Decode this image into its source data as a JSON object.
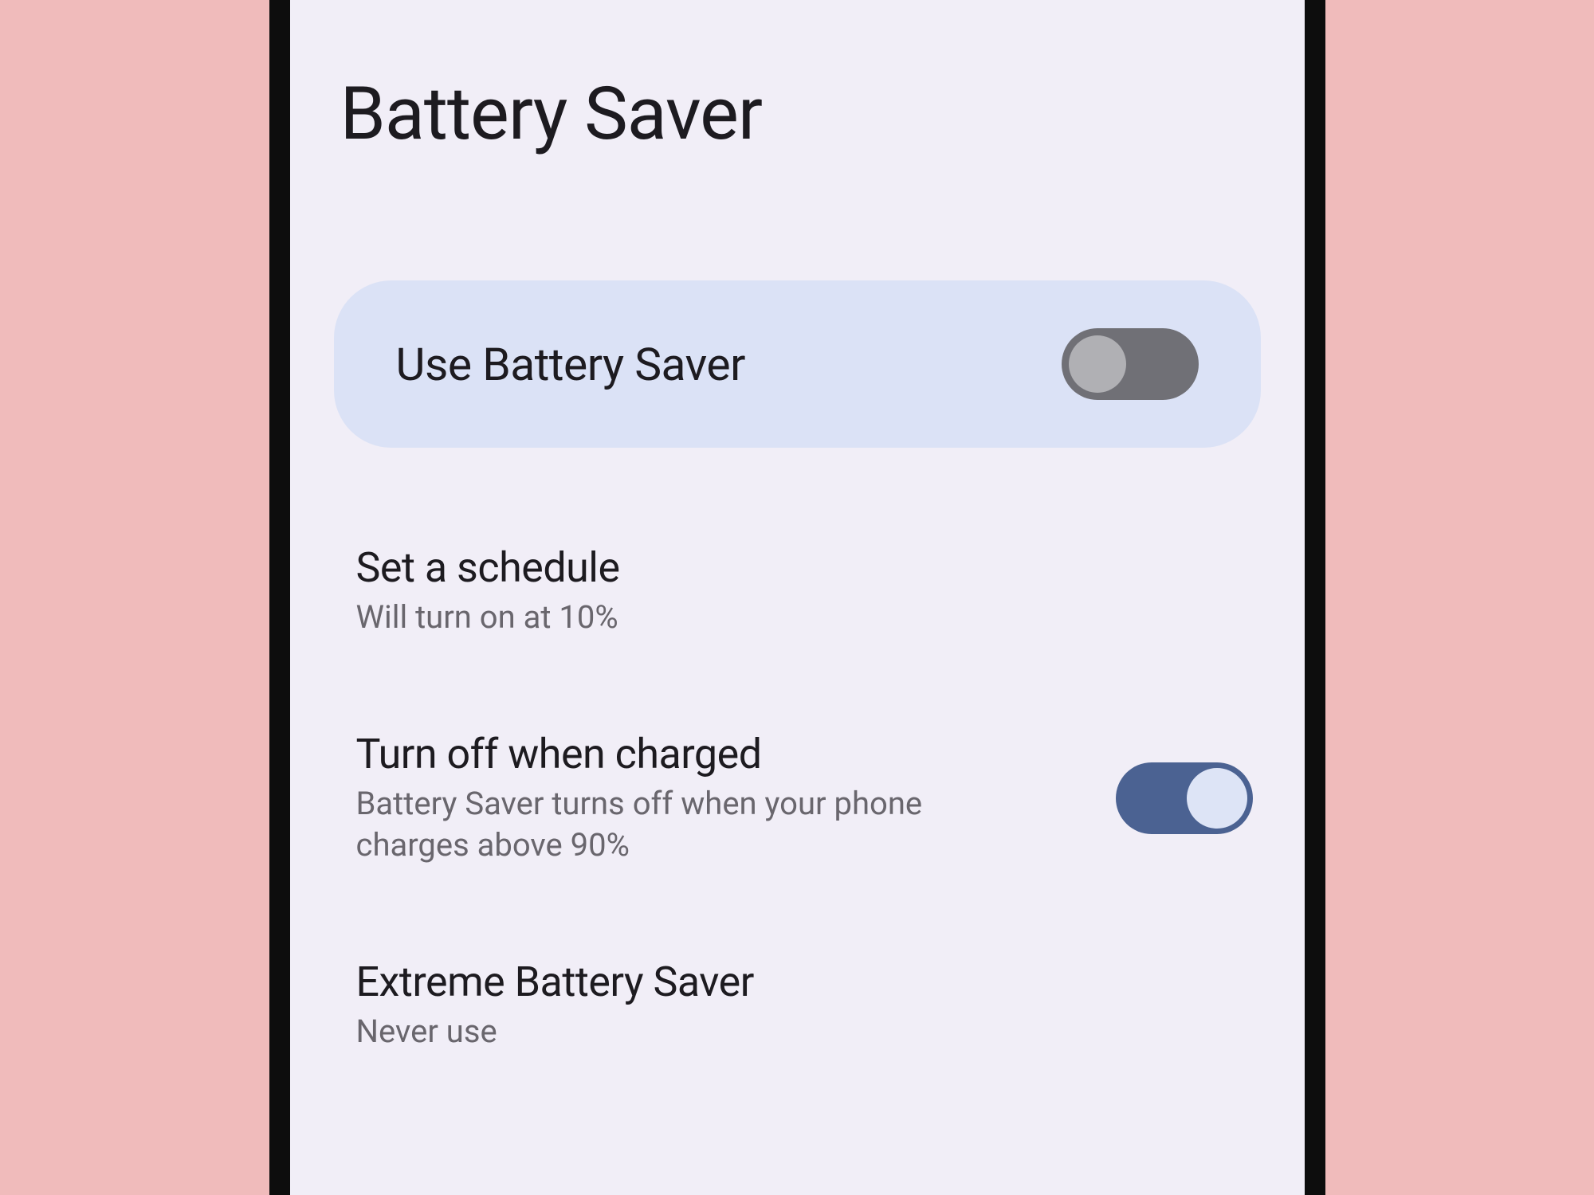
{
  "page": {
    "title": "Battery Saver"
  },
  "primary": {
    "label": "Use Battery Saver",
    "enabled": false
  },
  "settings": {
    "schedule": {
      "title": "Set a schedule",
      "subtitle": "Will turn on at 10%"
    },
    "turn_off_charged": {
      "title": "Turn off when charged",
      "subtitle": "Battery Saver turns off when your phone charges above 90%",
      "enabled": true
    },
    "extreme": {
      "title": "Extreme Battery Saver",
      "subtitle": "Never use"
    }
  },
  "colors": {
    "background_outer": "#f0bbbb",
    "device_frame": "#0d0d0d",
    "screen_bg": "#f1eef7",
    "card_bg": "#dbe2f6",
    "text_primary": "#1d1b20",
    "text_secondary": "#69666d",
    "toggle_off_track": "#707076",
    "toggle_off_thumb": "#b0b0b4",
    "toggle_on_track": "#4b6292",
    "toggle_on_thumb": "#dde4f6"
  }
}
